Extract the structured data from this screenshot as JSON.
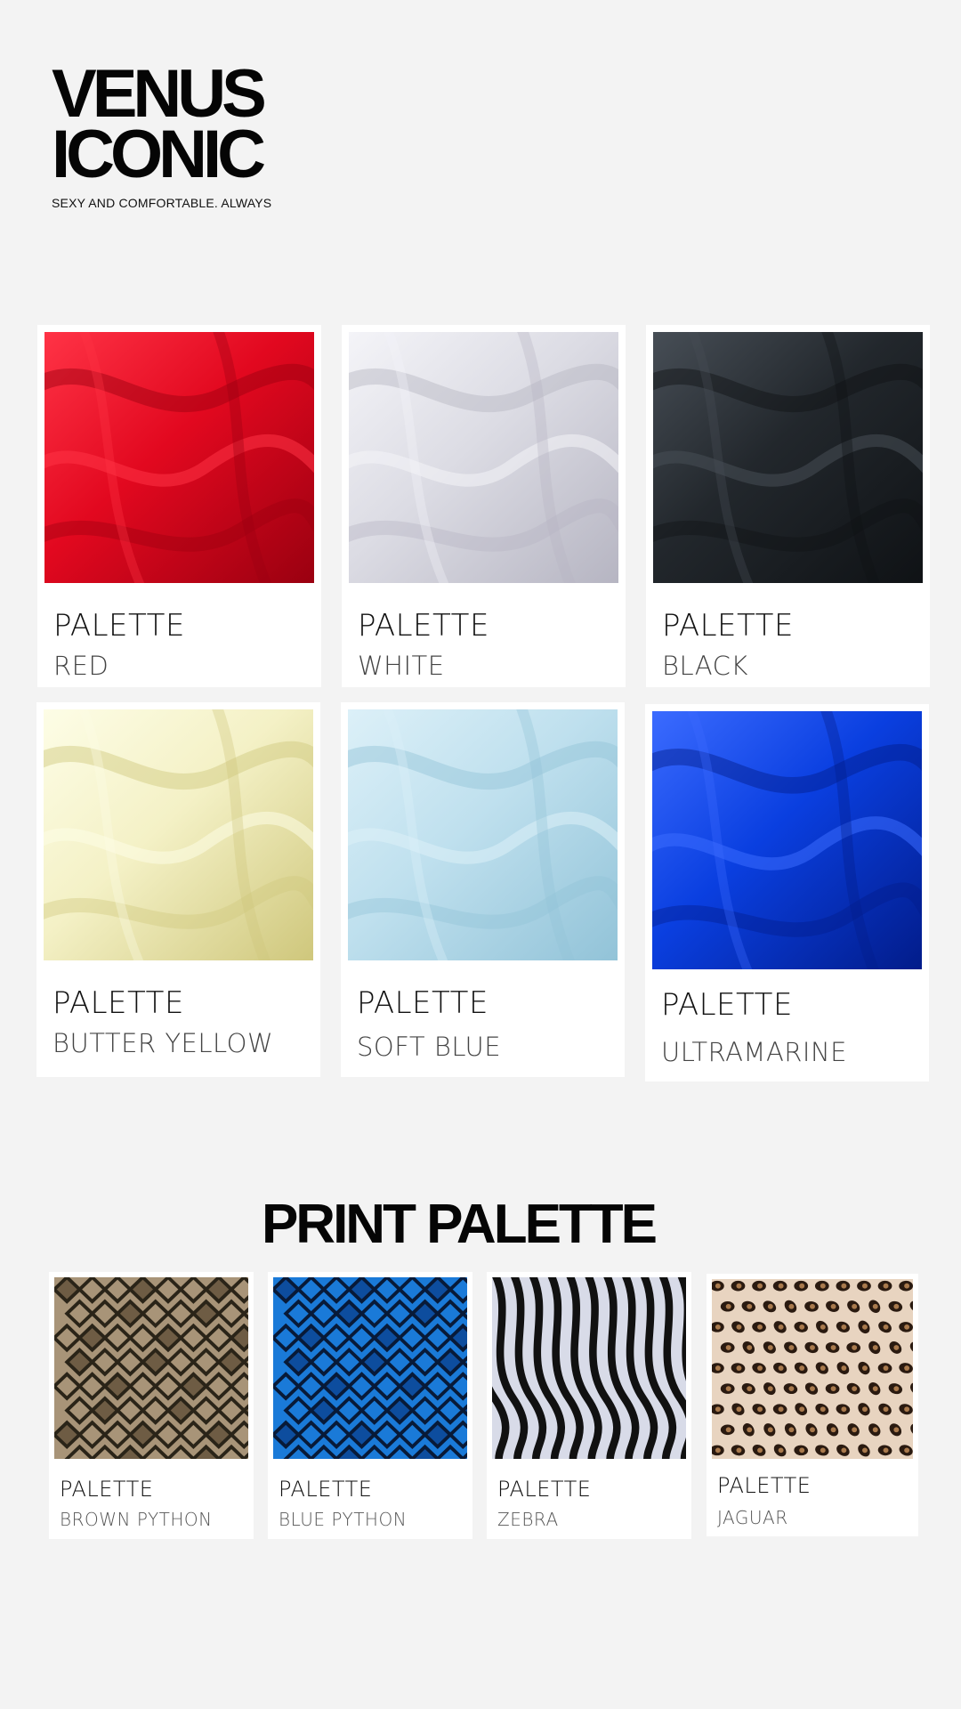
{
  "brand": {
    "title_line1": "VENUS",
    "title_line2": "ICONIC",
    "tagline": "SEXY AND COMFORTABLE. ALWAYS"
  },
  "solid_palettes": [
    {
      "title": "PALETTE",
      "name": "RED",
      "color": "#e2081f",
      "shade": "#9a0010",
      "highlight": "#ff3346"
    },
    {
      "title": "PALETTE",
      "name": "WHITE",
      "color": "#dcdce4",
      "shade": "#b6b5c2",
      "highlight": "#f4f4f8"
    },
    {
      "title": "PALETTE",
      "name": "BLACK",
      "color": "#22272c",
      "shade": "#0f1215",
      "highlight": "#474e56"
    },
    {
      "title": "PALETTE",
      "name": "BUTTER YELLOW",
      "color": "#f4f1c6",
      "shade": "#cfc77c",
      "highlight": "#fdfde6"
    },
    {
      "title": "PALETTE",
      "name": "SOFT BLUE",
      "color": "#bfe0ee",
      "shade": "#92c3d8",
      "highlight": "#dcf0f8"
    },
    {
      "title": "PALETTE",
      "name": "ULTRAMARINE",
      "color": "#0a3fe0",
      "shade": "#021c8a",
      "highlight": "#3b6bff"
    }
  ],
  "print_section_title": "PRINT PALETTE",
  "print_palettes": [
    {
      "title": "PALETTE",
      "name": "BROWN PYTHON",
      "base": "#a89478",
      "dark": "#2a2418",
      "mid": "#6e5c44"
    },
    {
      "title": "PALETTE",
      "name": "BLUE PYTHON",
      "base": "#1a7ad8",
      "dark": "#081a38",
      "mid": "#0d4d9e"
    },
    {
      "title": "PALETTE",
      "name": "ZEBRA",
      "base": "#d8dbe8",
      "dark": "#111111",
      "mid": "#8a8f9c"
    },
    {
      "title": "PALETTE",
      "name": "JAGUAR",
      "base": "#c9925c",
      "dark": "#2a1a10",
      "mid": "#e8d4c0"
    }
  ]
}
